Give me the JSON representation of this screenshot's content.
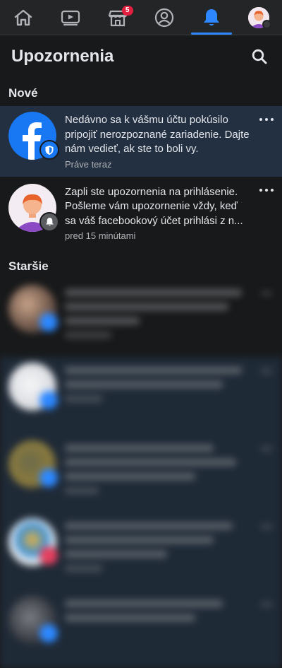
{
  "nav": {
    "items": [
      {
        "name": "home-icon"
      },
      {
        "name": "video-icon"
      },
      {
        "name": "marketplace-icon",
        "badge": "5"
      },
      {
        "name": "profile-icon"
      },
      {
        "name": "bell-icon",
        "active": true
      },
      {
        "name": "menu-avatar-icon"
      }
    ],
    "accent": "#2d88ff",
    "badge_color": "#e41e3f"
  },
  "header": {
    "title": "Upozornenia"
  },
  "sections": {
    "new_label": "Nové",
    "older_label": "Staršie"
  },
  "notifications": [
    {
      "text": "Nedávno sa k vášmu účtu pokúsilo pripojiť nerozpoznané zariadenie. Dajte nám vedieť, ak ste to boli vy.",
      "time": "Práve teraz",
      "avatar": "facebook-logo",
      "sub_icon": "shield-icon",
      "unread": true
    },
    {
      "text": "Zapli ste upozornenia na prihlásenie. Pošleme vám upozornenie vždy, keď sa váš facebookový účet prihlási z n...",
      "time": "pred 15 minútami",
      "avatar": "user-avatar",
      "sub_icon": "bell-icon",
      "unread": false
    }
  ]
}
